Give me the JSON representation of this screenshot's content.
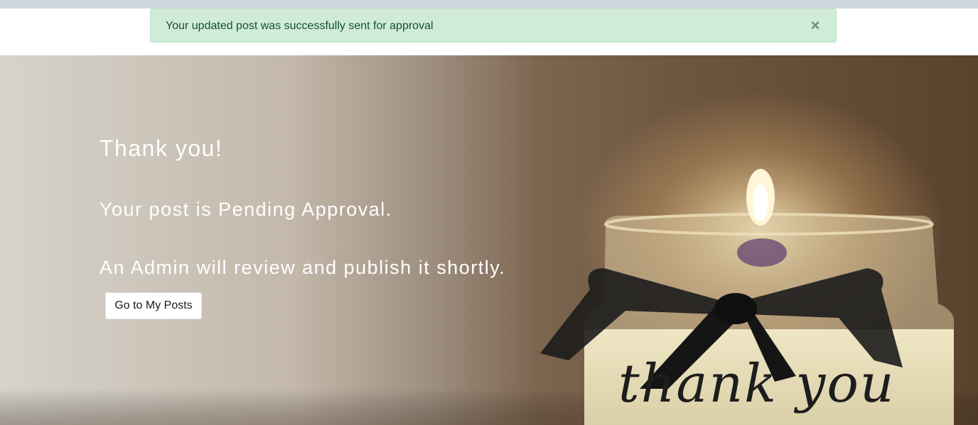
{
  "alert": {
    "message": "Your updated post was successfully sent for approval",
    "close_glyph": "×",
    "background": "#d1ebd9"
  },
  "hero": {
    "heading": "Thank you!",
    "status_line": "Your post is Pending Approval.",
    "info_line": "An Admin will review and publish it shortly.",
    "button_label": "Go to My Posts",
    "jar_inscription": "thank you"
  },
  "icons": {
    "close": "close-icon"
  }
}
